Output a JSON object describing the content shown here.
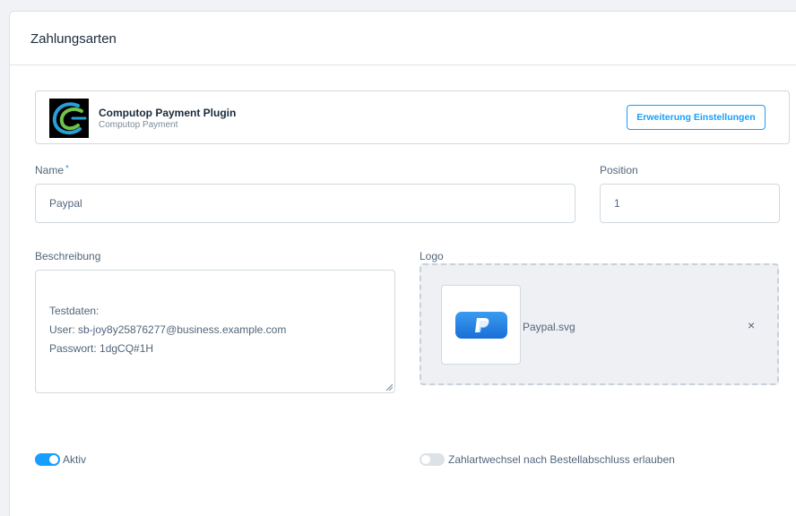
{
  "card": {
    "title": "Zahlungsarten"
  },
  "extension": {
    "name": "Computop Payment Plugin",
    "subtitle": "Computop Payment",
    "settings_button": "Erweiterung Einstellungen"
  },
  "form": {
    "name_label": "Name",
    "name_required_mark": "*",
    "name_value": "Paypal",
    "position_label": "Position",
    "position_value": "1",
    "description_label": "Beschreibung",
    "description_value": "Testdaten:\nUser: sb-joy8y25876277@business.example.com\nPasswort: 1dgCQ#1H",
    "logo_label": "Logo",
    "logo_file": "Paypal.svg",
    "logo_remove": "×"
  },
  "toggles": {
    "active": {
      "label": "Aktiv",
      "checked": true
    },
    "payment_change": {
      "label": "Zahlartwechsel nach Bestellabschluss erlauben",
      "checked": false
    }
  },
  "colors": {
    "accent": "#189eff",
    "text": "#52667a",
    "border": "#d1d9e0"
  }
}
